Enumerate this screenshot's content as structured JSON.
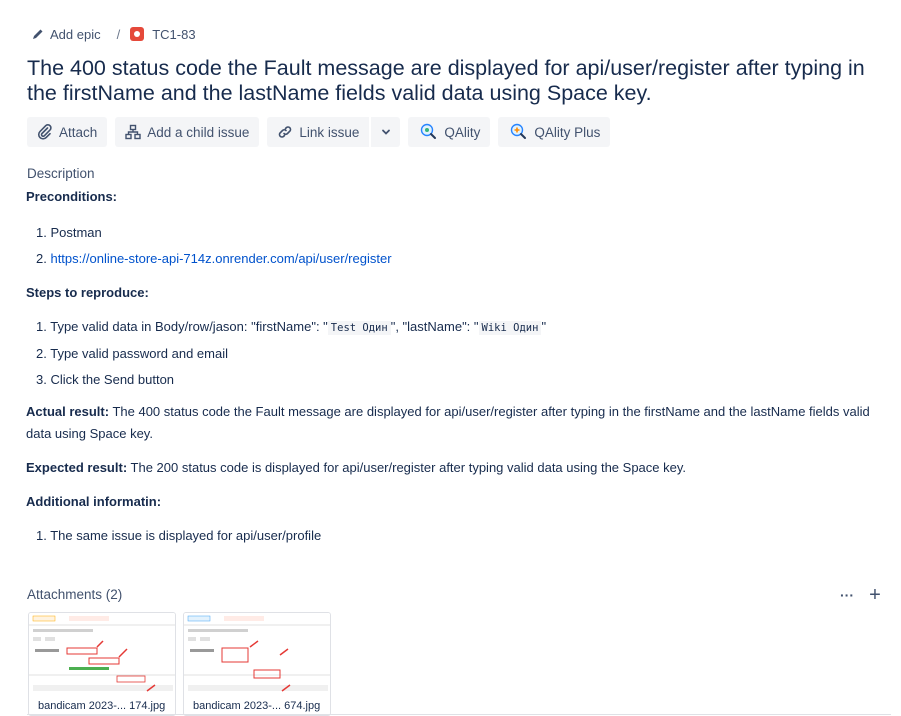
{
  "breadcrumb": {
    "add_epic": "Add epic",
    "separator": "/",
    "issue_key": "TC1-83"
  },
  "title": "The 400 status code the Fault message are displayed for api/user/register after typing in the firstName and the lastName fields valid data using Space key.",
  "toolbar": {
    "attach": "Attach",
    "add_child": "Add a child issue",
    "link_issue": "Link issue",
    "qality": "QAlity",
    "qality_plus": "QAlity Plus"
  },
  "description": {
    "label": "Description",
    "preconditions_heading": "Preconditions:",
    "preconditions": [
      "1. Postman",
      "2."
    ],
    "precondition_link": "https://online-store-api-714z.onrender.com/api/user/register",
    "steps_heading": "Steps to reproduce:",
    "step1": {
      "prefix": "1. Type valid data in Body/row/jason: \"firstName\": \"",
      "code1": "Test Один",
      "middle": "\", \"lastName\": \"",
      "code2": "Wiki Один",
      "suffix": "\""
    },
    "steps": [
      "2. Type valid password and email",
      "3. Click the Send button"
    ],
    "actual_label": "Actual result:",
    "actual_text": " The 400 status code the Fault message are displayed for api/user/register after typing in the firstName and the lastName fields valid data using Space key.",
    "expected_label": "Expected result:",
    "expected_text": " The 200 status code is displayed for api/user/register after typing valid data using the Space key.",
    "additional_heading": "Additional informatin:",
    "additional": [
      "1. The same issue is displayed for api/user/profile"
    ]
  },
  "attachments": {
    "label": "Attachments (2)",
    "more": "···",
    "add": "+",
    "files": [
      {
        "name": "bandicam 2023-... 174.jpg"
      },
      {
        "name": "bandicam 2023-... 674.jpg"
      }
    ]
  },
  "colors": {
    "bug": "#e5493a",
    "link": "#0052cc",
    "button_bg": "#f4f5f7"
  }
}
